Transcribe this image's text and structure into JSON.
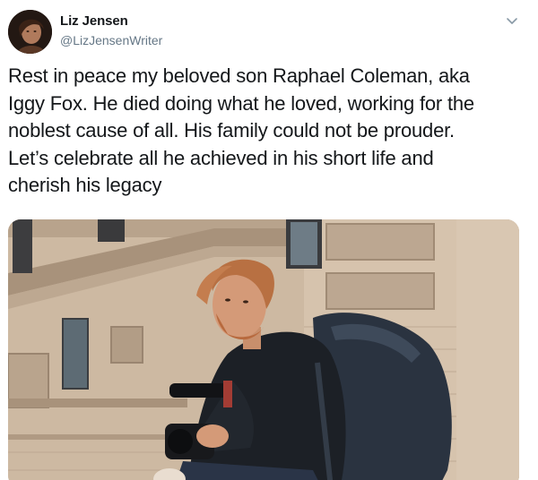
{
  "author": {
    "display_name": "Liz Jensen",
    "handle": "@LizJensenWriter",
    "avatar_icon": "profile-photo"
  },
  "menu": {
    "icon": "chevron-down-icon"
  },
  "tweet": {
    "text": "Rest in peace my beloved son Raphael Coleman, aka\nIggy Fox. He died doing what he loved, working for the\nnoblest cause of all. His family could not be prouder.\nLet’s celebrate all he achieved in his short life and\ncherish his legacy"
  },
  "media": {
    "description_icon": "photo"
  },
  "colors": {
    "text": "#14171a",
    "secondary": "#657786"
  }
}
